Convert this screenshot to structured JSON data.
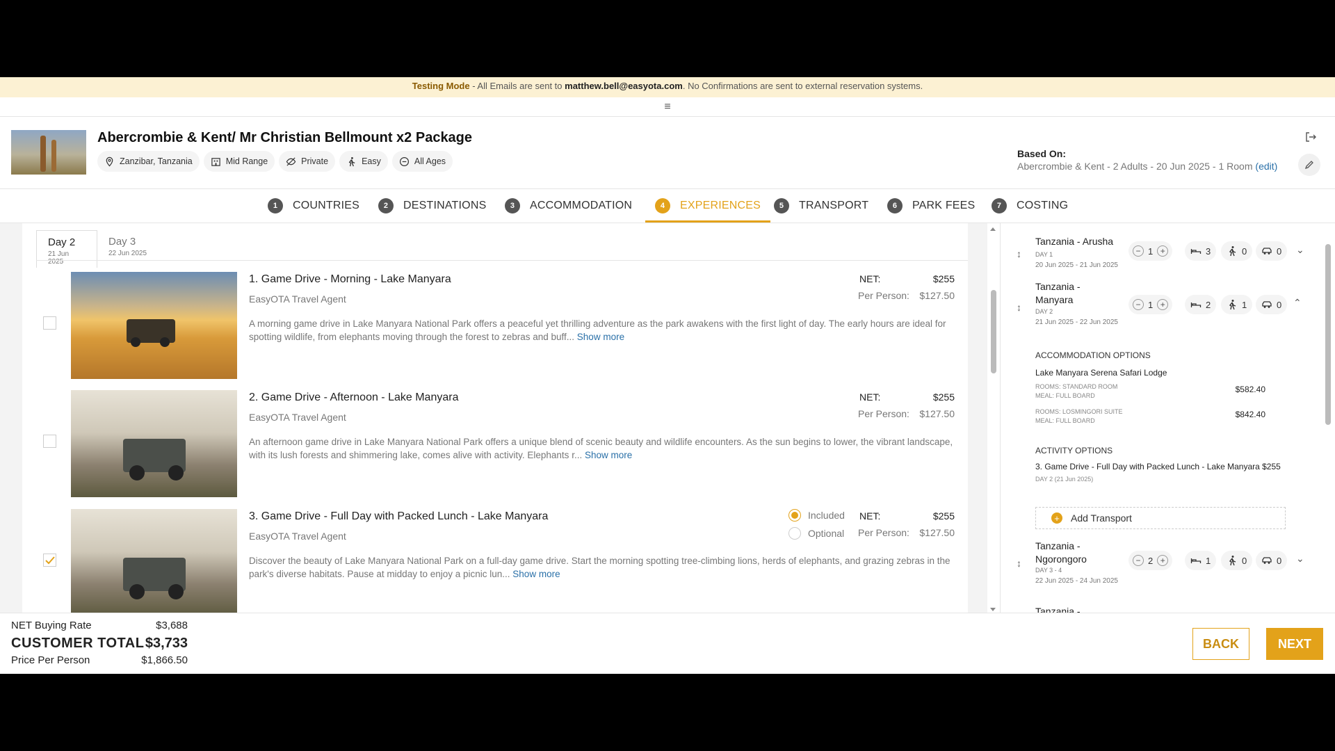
{
  "banner": {
    "mode": "Testing Mode",
    "text1": " - All Emails are sent to ",
    "email": "matthew.bell@easyota.com",
    "text2": ". No Confirmations are sent to external reservation systems."
  },
  "header": {
    "title": "Abercrombie & Kent/ Mr Christian Bellmount x2 Package",
    "chips": [
      "Zanzibar, Tanzania",
      "Mid Range",
      "Private",
      "Easy",
      "All Ages"
    ],
    "based_on_label": "Based On:",
    "based_on_value": "Abercrombie & Kent - 2 Adults - 20 Jun 2025 - 1 Room",
    "edit_link": "(edit)"
  },
  "steps": [
    {
      "num": "1",
      "label": "COUNTRIES"
    },
    {
      "num": "2",
      "label": "DESTINATIONS"
    },
    {
      "num": "3",
      "label": "ACCOMMODATION"
    },
    {
      "num": "4",
      "label": "EXPERIENCES"
    },
    {
      "num": "5",
      "label": "TRANSPORT"
    },
    {
      "num": "6",
      "label": "PARK FEES"
    },
    {
      "num": "7",
      "label": "COSTING"
    }
  ],
  "day_tabs": [
    {
      "label": "Day 2",
      "date": "21 Jun 2025"
    },
    {
      "label": "Day 3",
      "date": "22 Jun 2025"
    }
  ],
  "activities": [
    {
      "name": "1. Game Drive - Morning - Lake Manyara",
      "agent": "EasyOTA Travel Agent",
      "desc": "A morning game drive in Lake Manyara National Park offers a peaceful yet thrilling adventure as the park awakens with the first light of day. The early hours are ideal for spotting wildlife, from elephants moving through the forest to zebras and buff...",
      "net_label": "NET:",
      "net": "$255",
      "pp_label": "Per Person:",
      "pp": "$127.50",
      "checked": false
    },
    {
      "name": "2. Game Drive - Afternoon - Lake Manyara",
      "agent": "EasyOTA Travel Agent",
      "desc": "An afternoon game drive in Lake Manyara National Park offers a unique blend of scenic beauty and wildlife encounters. As the sun begins to lower, the vibrant landscape, with its lush forests and shimmering lake, comes alive with activity. Elephants r...",
      "net_label": "NET:",
      "net": "$255",
      "pp_label": "Per Person:",
      "pp": "$127.50",
      "checked": false
    },
    {
      "name": "3. Game Drive - Full Day with Packed Lunch - Lake Manyara",
      "agent": "EasyOTA Travel Agent",
      "desc": "Discover the beauty of Lake Manyara National Park  on a full-day game drive. Start the morning spotting tree-climbing lions, herds of elephants, and grazing zebras in the park's diverse habitats. Pause at midday to enjoy a picnic lun...",
      "net_label": "NET:",
      "net": "$255",
      "pp_label": "Per Person:",
      "pp": "$127.50",
      "checked": true,
      "included_label": "Included",
      "optional_label": "Optional"
    }
  ],
  "show_more": "Show more",
  "itinerary": {
    "locations": [
      {
        "name": "Tanzania - Arusha",
        "day": "DAY 1",
        "dates": "20 Jun 2025 - 21 Jun 2025",
        "nights": "1",
        "beds": "3",
        "acts": "0",
        "cars": "0"
      },
      {
        "name": "Tanzania - Manyara",
        "day": "DAY 2",
        "dates": "21 Jun 2025 - 22 Jun 2025",
        "nights": "1",
        "beds": "2",
        "acts": "1",
        "cars": "0"
      },
      {
        "name": "Tanzania - Ngorongoro",
        "day": "DAY 3 - 4",
        "dates": "22 Jun 2025 - 24 Jun 2025",
        "nights": "2",
        "beds": "1",
        "acts": "0",
        "cars": "0"
      }
    ],
    "accom_title": "ACCOMMODATION OPTIONS",
    "lodge": "Lake Manyara Serena Safari Lodge",
    "rooms": [
      {
        "room": "ROOMS: STANDARD ROOM",
        "meal": "MEAL: FULL BOARD",
        "price": "$582.40"
      },
      {
        "room": "ROOMS: LOSMINGORI SUITE",
        "meal": "MEAL: FULL BOARD",
        "price": "$842.40"
      }
    ],
    "activity_title": "ACTIVITY OPTIONS",
    "activity_item": "3. Game Drive - Full Day with Packed Lunch - Lake Manyara $255",
    "activity_date": "DAY 2  (21 Jun 2025)",
    "add_transport": "Add Transport",
    "next_partial": "Tanzania -"
  },
  "footer": {
    "net_label": "NET Buying Rate",
    "net_value": "$3,688",
    "total_label": "CUSTOMER TOTAL",
    "total_value": "$3,733",
    "pp_label": "Price Per Person",
    "pp_value": "$1,866.50",
    "back": "BACK",
    "next": "NEXT"
  },
  "colors": {
    "accent": "#e3a21a",
    "link": "#2a70a8",
    "banner_bg": "#fcf1d3"
  }
}
